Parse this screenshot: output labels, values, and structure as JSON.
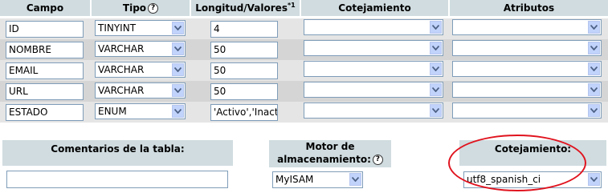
{
  "headers": {
    "campo": "Campo",
    "tipo": "Tipo",
    "longitud": "Longitud/Valores",
    "longitud_sup": "*1",
    "cotejamiento": "Cotejamiento",
    "atributos": "Atributos",
    "help_glyph": "?"
  },
  "rows": [
    {
      "campo": "ID",
      "tipo": "TINYINT",
      "longitud": "4",
      "cotejamiento": "",
      "atributos": ""
    },
    {
      "campo": "NOMBRE",
      "tipo": "VARCHAR",
      "longitud": "50",
      "cotejamiento": "",
      "atributos": ""
    },
    {
      "campo": "EMAIL",
      "tipo": "VARCHAR",
      "longitud": "50",
      "cotejamiento": "",
      "atributos": ""
    },
    {
      "campo": "URL",
      "tipo": "VARCHAR",
      "longitud": "50",
      "cotejamiento": "",
      "atributos": ""
    },
    {
      "campo": "ESTADO",
      "tipo": "ENUM",
      "longitud": "'Activo','Inactivo'",
      "cotejamiento": "",
      "atributos": ""
    }
  ],
  "bottom": {
    "comentarios_label": "Comentarios de la tabla:",
    "comentarios_value": "",
    "motor_label_line1": "Motor de",
    "motor_label_line2": "almacenamiento:",
    "motor_value": "MyISAM",
    "cotejamiento_label": "Cotejamiento:",
    "cotejamiento_value": "utf8_spanish_ci"
  },
  "colors": {
    "header_bg": "#d0dce0",
    "row_odd": "#e5e5e5",
    "row_even": "#d5d5d5",
    "highlight_oval": "#e0131e",
    "select_arrow": "#c1d3fb"
  },
  "icons": [
    "help-icon",
    "chevron-down-icon"
  ]
}
